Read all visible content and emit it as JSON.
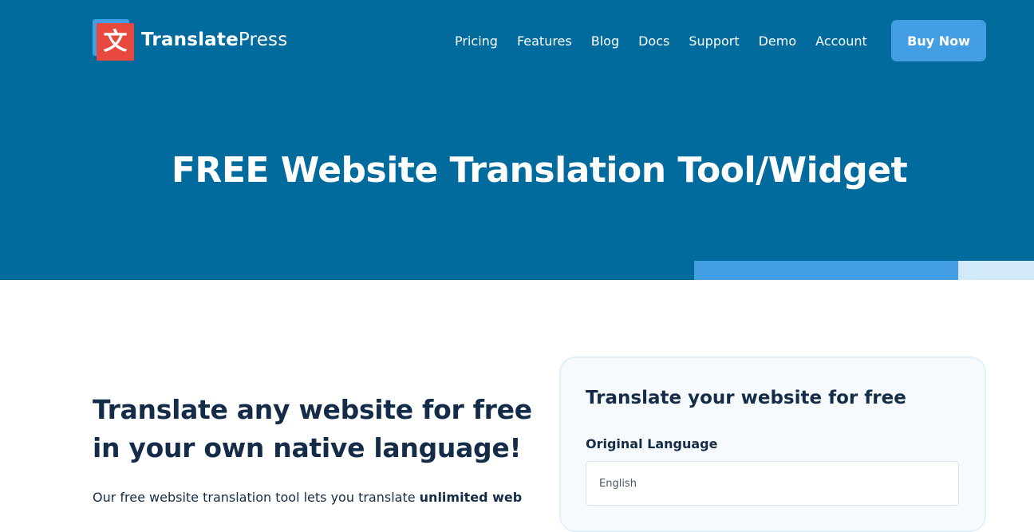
{
  "brand": {
    "logo_glyph": "文",
    "name_bold": "Translate",
    "name_regular": "Press",
    "colors": {
      "primary": "#006b9c",
      "accent": "#449ee3",
      "logo_red": "#e9483e",
      "text_dark": "#142c47"
    }
  },
  "nav": {
    "items": [
      {
        "label": "Pricing"
      },
      {
        "label": "Features"
      },
      {
        "label": "Blog"
      },
      {
        "label": "Docs"
      },
      {
        "label": "Support"
      },
      {
        "label": "Demo"
      },
      {
        "label": "Account"
      }
    ],
    "cta_label": "Buy Now"
  },
  "hero": {
    "title": "FREE Website Translation Tool/Widget"
  },
  "intro": {
    "heading": "Translate any website for free in your own native language!",
    "desc_prefix": "Our free website translation tool lets you translate ",
    "desc_bold": "unlimited web"
  },
  "tool": {
    "title": "Translate your website for free",
    "original_language_label": "Original Language",
    "original_language_value": "English"
  }
}
